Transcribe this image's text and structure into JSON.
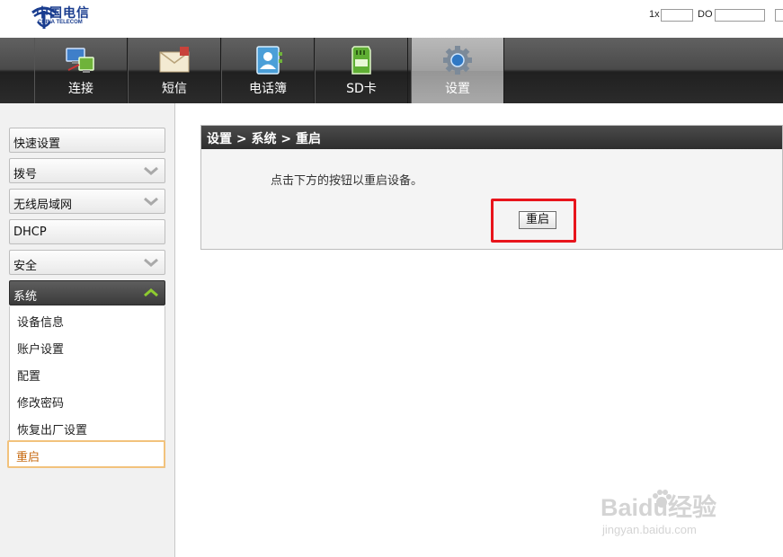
{
  "brand": {
    "logo_cn": "中国电信",
    "logo_en": "CHINA TELECOM"
  },
  "signal": {
    "label_1x": "1x",
    "label_do": "DO"
  },
  "nav": {
    "items": [
      {
        "label": "连接",
        "icon": "network-connect-icon"
      },
      {
        "label": "短信",
        "icon": "envelope-icon"
      },
      {
        "label": "电话簿",
        "icon": "phonebook-icon"
      },
      {
        "label": "SD卡",
        "icon": "sd-card-icon"
      },
      {
        "label": "设置",
        "icon": "gear-icon",
        "active": true
      }
    ]
  },
  "sidebar": {
    "items": [
      {
        "label": "快速设置",
        "expandable": false
      },
      {
        "label": "拨号",
        "expandable": true
      },
      {
        "label": "无线局域网",
        "expandable": true
      },
      {
        "label": "DHCP",
        "expandable": false
      },
      {
        "label": "安全",
        "expandable": true
      },
      {
        "label": "系统",
        "expandable": true,
        "open": true
      }
    ],
    "system_sub": [
      "设备信息",
      "账户设置",
      "配置",
      "修改密码",
      "恢复出厂设置",
      "重启"
    ]
  },
  "main": {
    "breadcrumb": "设置 > 系统 > 重启",
    "message": "点击下方的按钮以重启设备。",
    "reboot_button": "重启"
  },
  "colors": {
    "highlight_box": "#e8141c",
    "active_subitem_text": "#c76a12",
    "active_subitem_border": "#f2c27c",
    "chevron_green": "#8ecb2f"
  },
  "watermark": {
    "main": "Baidu经验",
    "sub": "jingyan.baidu.com"
  }
}
